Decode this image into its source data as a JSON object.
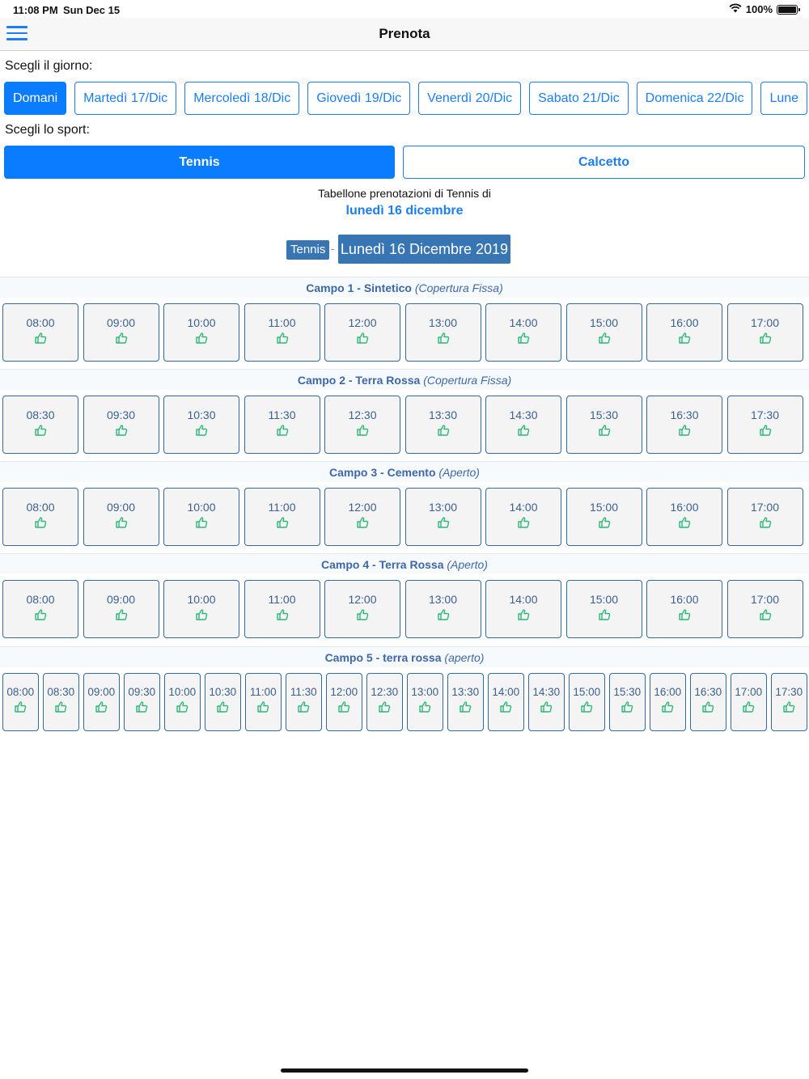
{
  "status": {
    "time": "11:08 PM",
    "date": "Sun Dec 15",
    "battery": "100%"
  },
  "nav": {
    "title": "Prenota"
  },
  "day_label": "Scegli il giorno:",
  "days": [
    "Domani",
    "Martedì 17/Dic",
    "Mercoledì 18/Dic",
    "Giovedì 19/Dic",
    "Venerdì 20/Dic",
    "Sabato 21/Dic",
    "Domenica 22/Dic",
    "Lune"
  ],
  "sport_label": "Scegli lo sport:",
  "sports": [
    "Tennis",
    "Calcetto"
  ],
  "board": {
    "caption": "Tabellone prenotazioni di Tennis di",
    "date": "lunedì 16 dicembre",
    "tag_sport": "Tennis",
    "tag_sep": "-",
    "tag_date": "Lunedì 16 Dicembre 2019"
  },
  "colors": {
    "accent": "#0a7cff",
    "tag": "#3775b3",
    "available": "#2db77a"
  },
  "courts": [
    {
      "name": "Campo 1 - Sintetico",
      "type": "(Copertura Fissa)",
      "slots": [
        "08:00",
        "09:00",
        "10:00",
        "11:00",
        "12:00",
        "13:00",
        "14:00",
        "15:00",
        "16:00",
        "17:00"
      ]
    },
    {
      "name": "Campo 2 - Terra Rossa",
      "type": "(Copertura Fissa)",
      "slots": [
        "08:30",
        "09:30",
        "10:30",
        "11:30",
        "12:30",
        "13:30",
        "14:30",
        "15:30",
        "16:30",
        "17:30"
      ]
    },
    {
      "name": "Campo 3 - Cemento",
      "type": "(Aperto)",
      "slots": [
        "08:00",
        "09:00",
        "10:00",
        "11:00",
        "12:00",
        "13:00",
        "14:00",
        "15:00",
        "16:00",
        "17:00"
      ]
    },
    {
      "name": "Campo 4 - Terra Rossa",
      "type": "(Aperto)",
      "slots": [
        "08:00",
        "09:00",
        "10:00",
        "11:00",
        "12:00",
        "13:00",
        "14:00",
        "15:00",
        "16:00",
        "17:00"
      ]
    },
    {
      "name": "Campo 5 - terra rossa",
      "type": "(aperto)",
      "slots": [
        "08:00",
        "08:30",
        "09:00",
        "09:30",
        "10:00",
        "10:30",
        "11:00",
        "11:30",
        "12:00",
        "12:30",
        "13:00",
        "13:30",
        "14:00",
        "14:30",
        "15:00",
        "15:30",
        "16:00",
        "16:30",
        "17:00",
        "17:30"
      ]
    }
  ],
  "slot_icon": "thumbs-up-icon"
}
